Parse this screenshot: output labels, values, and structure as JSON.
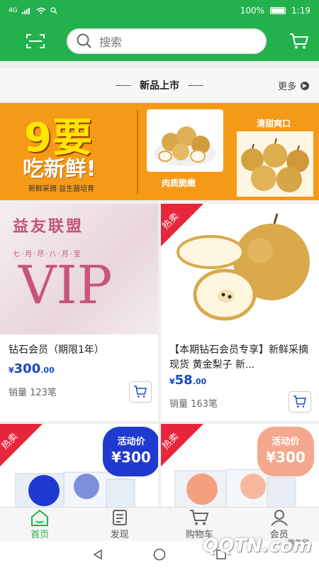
{
  "status_bar": {
    "signal": "4G",
    "battery": "100%",
    "time": "1:19"
  },
  "header": {
    "search_placeholder": "搜索",
    "icons": [
      "scan-icon",
      "search-icon",
      "cart-icon"
    ]
  },
  "section": {
    "title": "新品上市",
    "more_label": "更多"
  },
  "banner": {
    "headline": "9要",
    "subline": "吃新鲜",
    "exclaim": "!",
    "tagline": "新鲜采摘  益生菌培育",
    "caption_left": "肉质脆嫩",
    "caption_right": "清甜爽口"
  },
  "products": [
    {
      "image_title": "益友联盟",
      "image_sub": "七·月·尽·八·月·至",
      "image_big": "VIP",
      "title": "钻石会员（期限1年）",
      "currency": "¥",
      "price_int": "300",
      "price_dec": ".00",
      "sales": "销量 123笔"
    },
    {
      "hot_label": "热卖",
      "title": "【本期钻石会员专享】新鲜采摘现货 黄金梨子 新...",
      "currency": "¥",
      "price_int": "58",
      "price_dec": ".00",
      "sales": "销量 163笔"
    },
    {
      "hot_label": "热卖",
      "badge_line1": "活动价",
      "badge_line2": "¥300",
      "badge_color": "#1e3ad1"
    },
    {
      "hot_label": "热卖",
      "badge_line1": "活动价",
      "badge_line2": "¥300",
      "badge_color": "#f4a98e"
    }
  ],
  "bottom_nav": [
    {
      "label": "首页",
      "icon": "home-icon",
      "active": true
    },
    {
      "label": "发现",
      "icon": "discover-icon",
      "active": false
    },
    {
      "label": "购物车",
      "icon": "cart-icon",
      "active": false
    },
    {
      "label": "会员",
      "icon": "member-icon",
      "active": false
    }
  ],
  "watermark": {
    "text": "QQTN.com",
    "small": "腾牛网"
  },
  "colors": {
    "brand_green": "#22b14c",
    "price_blue": "#1747c7",
    "hot_red": "#e8263b",
    "banner_orange": "#f59a17"
  }
}
